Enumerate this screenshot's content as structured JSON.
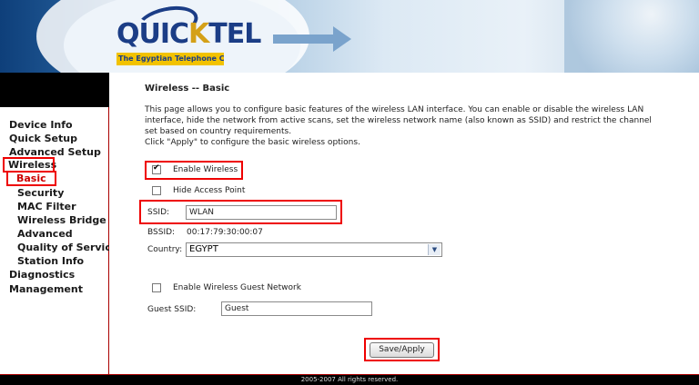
{
  "header": {
    "brand_name_part1": "QUIC",
    "brand_name_k": "K",
    "brand_name_part2": "TEL",
    "brand_tagline": "The Egyptian Telephone Co."
  },
  "sidebar": {
    "items": [
      {
        "label": "Device Info"
      },
      {
        "label": "Quick Setup"
      },
      {
        "label": "Advanced Setup"
      },
      {
        "label": "Wireless"
      },
      {
        "label": "Basic"
      },
      {
        "label": "Security"
      },
      {
        "label": "MAC Filter"
      },
      {
        "label": "Wireless Bridge"
      },
      {
        "label": "Advanced"
      },
      {
        "label": "Quality of Service"
      },
      {
        "label": "Station Info"
      },
      {
        "label": "Diagnostics"
      },
      {
        "label": "Management"
      }
    ]
  },
  "main": {
    "title": "Wireless -- Basic",
    "description": "This page allows you to configure basic features of the wireless LAN interface. You can enable or disable the wireless LAN interface, hide the network from active scans, set the wireless network name (also known as SSID) and restrict the channel set based on country requirements.",
    "description2": "Click \"Apply\" to configure the basic wireless options.",
    "enable_wireless_label": "Enable Wireless",
    "enable_wireless_checked": true,
    "hide_ap_label": "Hide Access Point",
    "hide_ap_checked": false,
    "ssid_label": "SSID:",
    "ssid_value": "WLAN",
    "bssid_label": "BSSID:",
    "bssid_value": "00:17:79:30:00:07",
    "country_label": "Country:",
    "country_value": "EGYPT",
    "guest_network_label": "Enable Wireless Guest Network",
    "guest_network_checked": false,
    "guest_ssid_label": "Guest SSID:",
    "guest_ssid_value": "Guest",
    "apply_button_label": "Save/Apply"
  },
  "footer": {
    "copyright": "2005-2007 All rights reserved."
  },
  "colors": {
    "highlight_red": "#e00000",
    "header_blue": "#1b3d86",
    "logo_yellow": "#f2c200"
  }
}
